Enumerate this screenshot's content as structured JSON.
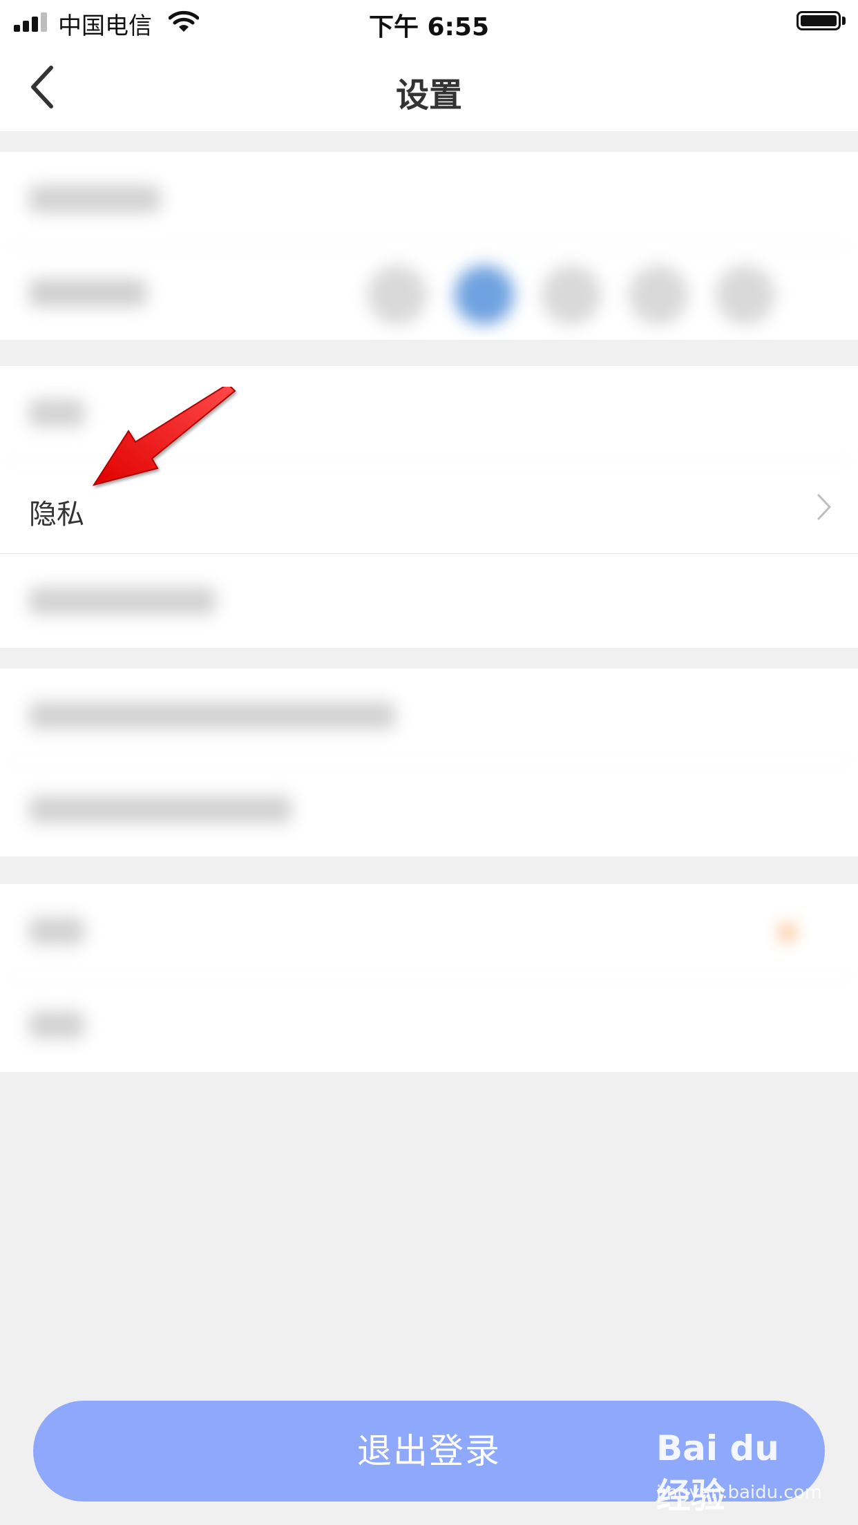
{
  "status_bar": {
    "carrier": "中国电信",
    "time": "下午 6:55"
  },
  "nav": {
    "title": "设置"
  },
  "settings": {
    "privacy_label": "隐私"
  },
  "logout": {
    "label": "退出登录"
  },
  "watermark": {
    "logo": "Bai du 经验",
    "url": "jingyan.baidu.com"
  },
  "colors": {
    "accent": "#8ea8fc",
    "selected_dot": "#6fa2e0",
    "annotation_arrow": "#ff0000"
  },
  "icons": {
    "back": "chevron-left-icon",
    "row_chevron": "chevron-right-icon"
  }
}
